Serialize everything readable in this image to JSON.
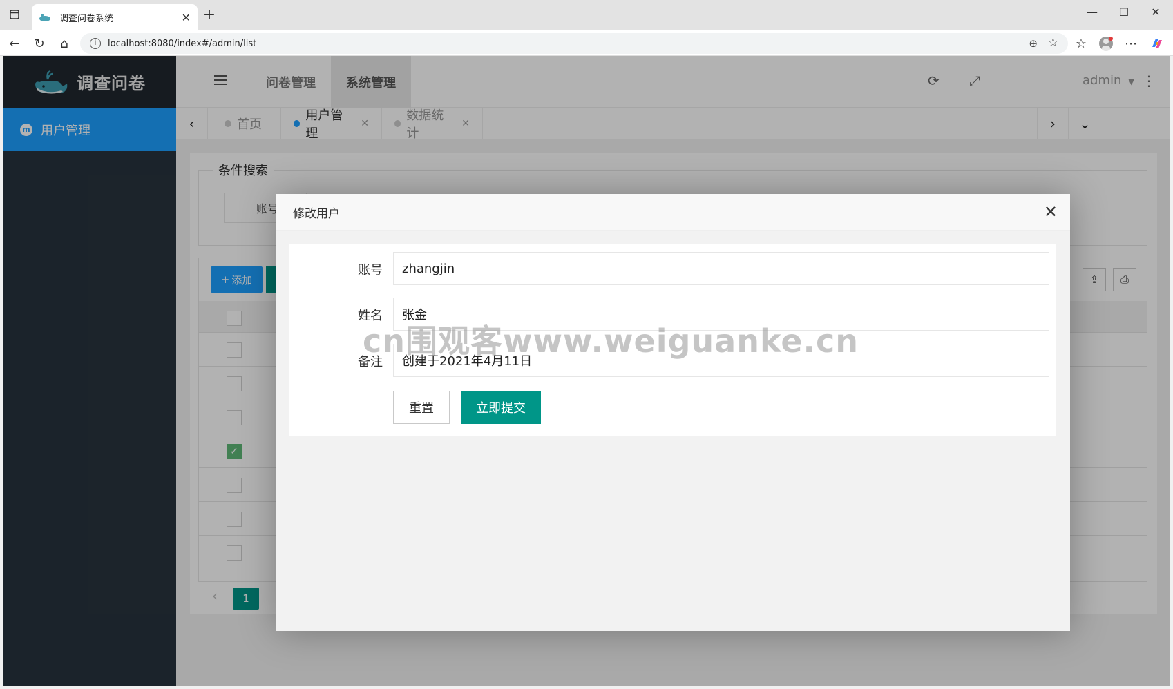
{
  "browser": {
    "tab_title": "调查问卷系统",
    "url": "localhost:8080/index#/admin/list"
  },
  "app": {
    "logo_text": "调查问卷",
    "sidebar": {
      "items": [
        {
          "label": "用户管理",
          "icon": "user-manage-icon"
        }
      ]
    },
    "header": {
      "nav": [
        {
          "label": "问卷管理"
        },
        {
          "label": "系统管理"
        }
      ],
      "user": "admin"
    },
    "page_tabs": [
      {
        "label": "首页"
      },
      {
        "label": "用户管理"
      },
      {
        "label": "数据统计"
      }
    ],
    "search": {
      "legend": "条件搜索",
      "account_label": "账号"
    },
    "toolbar": {
      "add_label": "添加"
    },
    "table": {
      "rows_checked": [
        false,
        false,
        false,
        true,
        false,
        false,
        false
      ]
    },
    "pager": {
      "current_page": "1"
    }
  },
  "modal": {
    "title": "修改用户",
    "fields": [
      {
        "label": "账号",
        "value": "zhangjin"
      },
      {
        "label": "姓名",
        "value": "张金"
      },
      {
        "label": "备注",
        "value": "创建于2021年4月11日"
      }
    ],
    "reset_label": "重置",
    "submit_label": "立即提交"
  },
  "watermark": "cn围观客www.weiguanke.cn",
  "colors": {
    "accent_blue": "#1e9fff",
    "accent_green": "#009688",
    "sidebar_dark": "#28333e"
  }
}
